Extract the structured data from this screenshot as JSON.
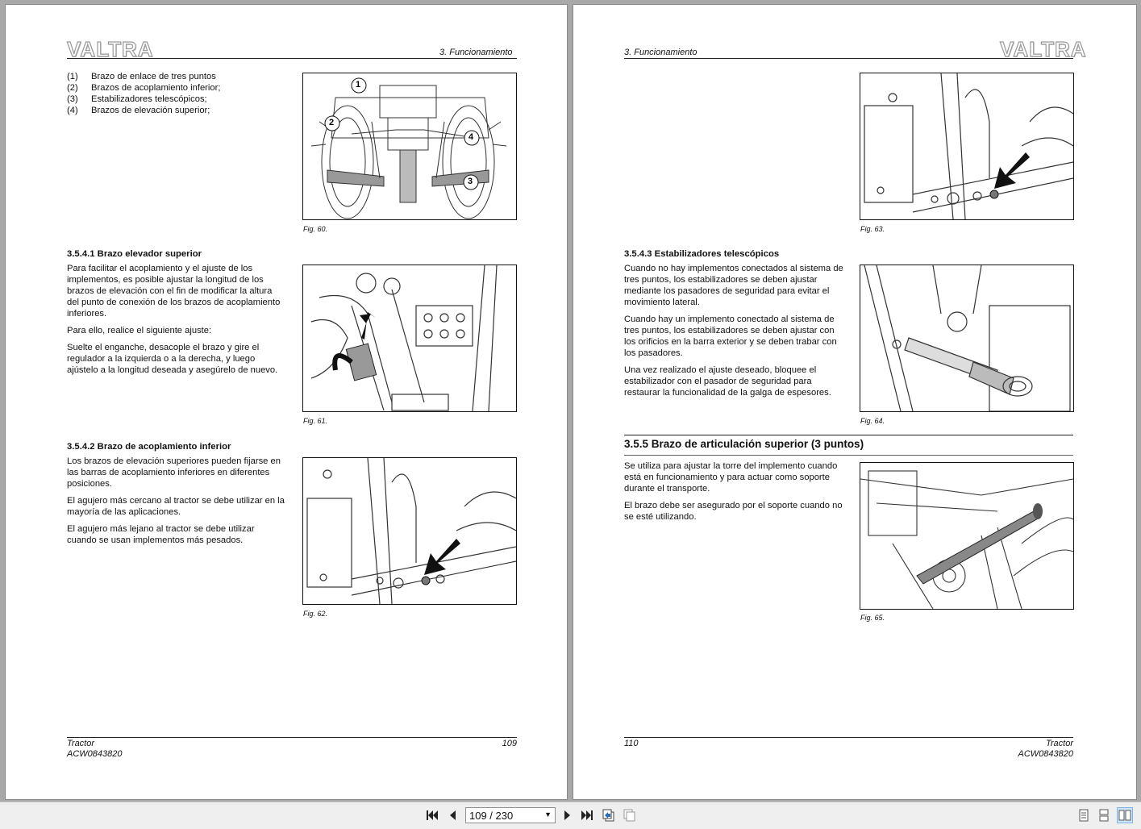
{
  "left_page": {
    "logo": "VALTRA",
    "section": "3. Funcionamiento",
    "legend": [
      {
        "num": "(1)",
        "text": "Brazo de enlace de tres puntos"
      },
      {
        "num": "(2)",
        "text": "Brazos de acoplamiento inferior;"
      },
      {
        "num": "(3)",
        "text": "Estabilizadores telescópicos;"
      },
      {
        "num": "(4)",
        "text": "Brazos de elevación superior;"
      }
    ],
    "fig60": {
      "caption": "Fig. 60.",
      "labels": [
        "1",
        "2",
        "3",
        "4"
      ]
    },
    "s3541": {
      "heading": "3.5.4.1  Brazo elevador superior",
      "p1": "Para facilitar el acoplamiento y el ajuste de los implementos, es posible ajustar la longitud de los brazos de elevación con el fin de modificar la altura del punto de conexión de los brazos de acoplamiento inferiores.",
      "p2": "Para ello, realice el siguiente ajuste:",
      "p3": "Suelte el enganche, desacople el brazo y gire el regulador a la izquierda o a la derecha, y luego ajústelo a la longitud deseada y asegúrelo de nuevo."
    },
    "fig61": {
      "caption": "Fig. 61."
    },
    "s3542": {
      "heading": "3.5.4.2  Brazo de acoplamiento inferior",
      "p1": "Los brazos de elevación superiores pueden fijarse en las barras de acoplamiento inferiores en diferentes posiciones.",
      "p2": "El agujero más cercano al tractor se debe utilizar en la mayoría de las aplicaciones.",
      "p3": "El agujero más lejano al tractor se debe utilizar cuando se usan implementos más pesados."
    },
    "fig62": {
      "caption": "Fig. 62."
    },
    "footer": {
      "model": "Tractor",
      "code": "ACW0843820",
      "page": "109"
    }
  },
  "right_page": {
    "logo": "VALTRA",
    "section": "3. Funcionamiento",
    "fig63": {
      "caption": "Fig. 63."
    },
    "s3543": {
      "heading": "3.5.4.3  Estabilizadores telescópicos",
      "p1": "Cuando no hay implementos conectados al sistema de tres puntos, los estabilizadores se deben ajustar mediante los pasadores de seguridad para evitar el movimiento lateral.",
      "p2": "Cuando hay un implemento conectado al sistema de tres puntos, los estabilizadores se deben ajustar con los orificios en la barra exterior y se deben trabar con los pasadores.",
      "p3": "Una vez realizado el ajuste deseado, bloquee el estabilizador con el pasador de seguridad para restaurar la funcionalidad de la galga de espesores."
    },
    "fig64": {
      "caption": "Fig. 64."
    },
    "s355": {
      "heading": "3.5.5  Brazo de articulación superior (3 puntos)",
      "p1": "Se utiliza para ajustar la torre del implemento cuando está en funcionamiento y para actuar como soporte durante el transporte.",
      "p2": "El brazo debe ser asegurado por el soporte cuando no se esté utilizando."
    },
    "fig65": {
      "caption": "Fig. 65."
    },
    "footer": {
      "model": "Tractor",
      "code": "ACW0843820",
      "page": "110"
    }
  },
  "toolbar": {
    "page_display": "109 / 230",
    "icons": [
      "first-page-icon",
      "previous-page-icon",
      "next-page-icon",
      "last-page-icon",
      "previous-view-icon",
      "next-view-icon",
      "single-page-view-icon",
      "continuous-view-icon",
      "facing-pages-view-icon"
    ],
    "active_view": "facing-pages-view-icon",
    "colors": {
      "bar": "#efefef",
      "active": "#cde3f6"
    }
  }
}
